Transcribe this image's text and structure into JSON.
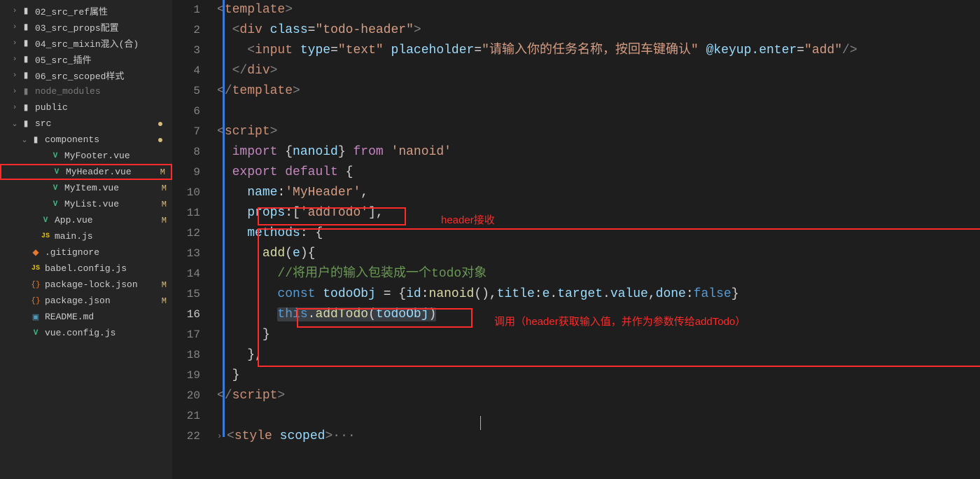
{
  "sidebar": {
    "items": [
      {
        "label": "02_src_ref属性",
        "icon": "folder",
        "chevron": "right",
        "indent": 14
      },
      {
        "label": "03_src_props配置",
        "icon": "folder",
        "chevron": "right",
        "indent": 14
      },
      {
        "label": "04_src_mixin混入(合)",
        "icon": "folder",
        "chevron": "right",
        "indent": 14
      },
      {
        "label": "05_src_插件",
        "icon": "folder",
        "chevron": "right",
        "indent": 14
      },
      {
        "label": "06_src_scoped样式",
        "icon": "folder",
        "chevron": "right",
        "indent": 14
      },
      {
        "label": "node_modules",
        "icon": "folder-dim",
        "chevron": "right",
        "indent": 14,
        "dim": true
      },
      {
        "label": "public",
        "icon": "folder",
        "chevron": "right",
        "indent": 14
      },
      {
        "label": "src",
        "icon": "folder",
        "chevron": "down",
        "indent": 14,
        "dot": true
      },
      {
        "label": "components",
        "icon": "folder",
        "chevron": "down",
        "indent": 28,
        "dot": true
      },
      {
        "label": "MyFooter.vue",
        "icon": "vue",
        "chevron": "",
        "indent": 56
      },
      {
        "label": "MyHeader.vue",
        "icon": "vue",
        "chevron": "",
        "indent": 56,
        "status": "M",
        "selected": true
      },
      {
        "label": "MyItem.vue",
        "icon": "vue",
        "chevron": "",
        "indent": 56,
        "status": "M"
      },
      {
        "label": "MyList.vue",
        "icon": "vue",
        "chevron": "",
        "indent": 56,
        "status": "M"
      },
      {
        "label": "App.vue",
        "icon": "vue",
        "chevron": "",
        "indent": 42,
        "status": "M"
      },
      {
        "label": "main.js",
        "icon": "js",
        "chevron": "",
        "indent": 42
      },
      {
        "label": ".gitignore",
        "icon": "git",
        "chevron": "",
        "indent": 28
      },
      {
        "label": "babel.config.js",
        "icon": "js",
        "chevron": "",
        "indent": 28
      },
      {
        "label": "package-lock.json",
        "icon": "json",
        "chevron": "",
        "indent": 28,
        "status": "M"
      },
      {
        "label": "package.json",
        "icon": "json",
        "chevron": "",
        "indent": 28,
        "status": "M"
      },
      {
        "label": "README.md",
        "icon": "md",
        "chevron": "",
        "indent": 28
      },
      {
        "label": "vue.config.js",
        "icon": "vue",
        "chevron": "",
        "indent": 28
      }
    ]
  },
  "editor": {
    "lines": [
      {
        "n": 1,
        "html": "<span class='c-br'>&lt;</span><span class='c-tag'>template</span><span class='c-br'>&gt;</span>"
      },
      {
        "n": 2,
        "html": "  <span class='c-br'>&lt;</span><span class='c-tag'>div</span> <span class='c-attr'>class</span><span class='c-pl'>=</span><span class='c-str'>\"todo-header\"</span><span class='c-br'>&gt;</span>"
      },
      {
        "n": 3,
        "html": "    <span class='c-br'>&lt;</span><span class='c-tag'>input</span> <span class='c-attr'>type</span><span class='c-pl'>=</span><span class='c-str'>\"text\"</span> <span class='c-attr'>placeholder</span><span class='c-pl'>=</span><span class='c-str'>\"请输入你的任务名称，按回车键确认\"</span> <span class='c-attr'>@keyup.enter</span><span class='c-pl'>=</span><span class='c-str'>\"add\"</span><span class='c-br'>/&gt;</span>"
      },
      {
        "n": 4,
        "html": "  <span class='c-br'>&lt;/</span><span class='c-tag'>div</span><span class='c-br'>&gt;</span>"
      },
      {
        "n": 5,
        "html": "<span class='c-br'>&lt;/</span><span class='c-tag'>template</span><span class='c-br'>&gt;</span>"
      },
      {
        "n": 6,
        "html": ""
      },
      {
        "n": 7,
        "html": "<span class='c-br'>&lt;</span><span class='c-tag'>script</span><span class='c-br'>&gt;</span>"
      },
      {
        "n": 8,
        "html": "  <span class='c-kw2'>import</span> <span class='c-pu'>{</span><span class='c-id'>nanoid</span><span class='c-pu'>}</span> <span class='c-kw2'>from</span> <span class='c-str'>'nanoid'</span>"
      },
      {
        "n": 9,
        "html": "  <span class='c-kw2'>export</span> <span class='c-kw2'>default</span> <span class='c-pu'>{</span>"
      },
      {
        "n": 10,
        "html": "    <span class='c-id'>name</span><span class='c-pu'>:</span><span class='c-str'>'MyHeader'</span><span class='c-pu'>,</span>"
      },
      {
        "n": 11,
        "html": "    <span class='c-id'>props</span><span class='c-pu'>:[</span><span class='c-str'>'addTodo'</span><span class='c-pu'>],</span>"
      },
      {
        "n": 12,
        "html": "    <span class='c-id'>methods</span><span class='c-pu'>: {</span>"
      },
      {
        "n": 13,
        "html": "      <span class='c-fn'>add</span><span class='c-pu'>(</span><span class='c-id'>e</span><span class='c-pu'>){</span>"
      },
      {
        "n": 14,
        "html": "        <span class='c-cm'>//将用户的输入包装成一个todo对象</span>"
      },
      {
        "n": 15,
        "html": "        <span class='c-kw'>const</span> <span class='c-id'>todoObj</span> <span class='c-pu'>= {</span><span class='c-id'>id</span><span class='c-pu'>:</span><span class='c-fn'>nanoid</span><span class='c-pu'>(),</span><span class='c-id'>title</span><span class='c-pu'>:</span><span class='c-id'>e</span><span class='c-pu'>.</span><span class='c-id'>target</span><span class='c-pu'>.</span><span class='c-id'>value</span><span class='c-pu'>,</span><span class='c-id'>done</span><span class='c-pu'>:</span><span class='c-kw'>false</span><span class='c-pu'>}</span>"
      },
      {
        "n": 16,
        "html": "        <span class='hl'><span class='c-kw'>this</span><span class='c-pu'>.</span><span class='c-fn'>addTodo</span><span class='c-pu'>(</span><span class='c-id'>todoObj</span><span class='c-pu'>)</span></span>",
        "active": true
      },
      {
        "n": 17,
        "html": "      <span class='c-pu'>}</span>"
      },
      {
        "n": 18,
        "html": "    <span class='c-pu'>},</span>"
      },
      {
        "n": 19,
        "html": "  <span class='c-pu'>}</span>"
      },
      {
        "n": 20,
        "html": "<span class='c-br'>&lt;/</span><span class='c-tag'>script</span><span class='c-br'>&gt;</span>"
      },
      {
        "n": 21,
        "html": ""
      },
      {
        "n": 22,
        "html": "<span class='c-br'>&lt;</span><span class='c-tag'>style</span> <span class='c-attr'>scoped</span><span class='c-br'>&gt;</span><span class='c-br'>···</span>",
        "folded": true
      }
    ]
  },
  "annotations": {
    "label1": "header接收",
    "label2": "调用（header获取输入值，并作为参数传给addTodo）"
  }
}
